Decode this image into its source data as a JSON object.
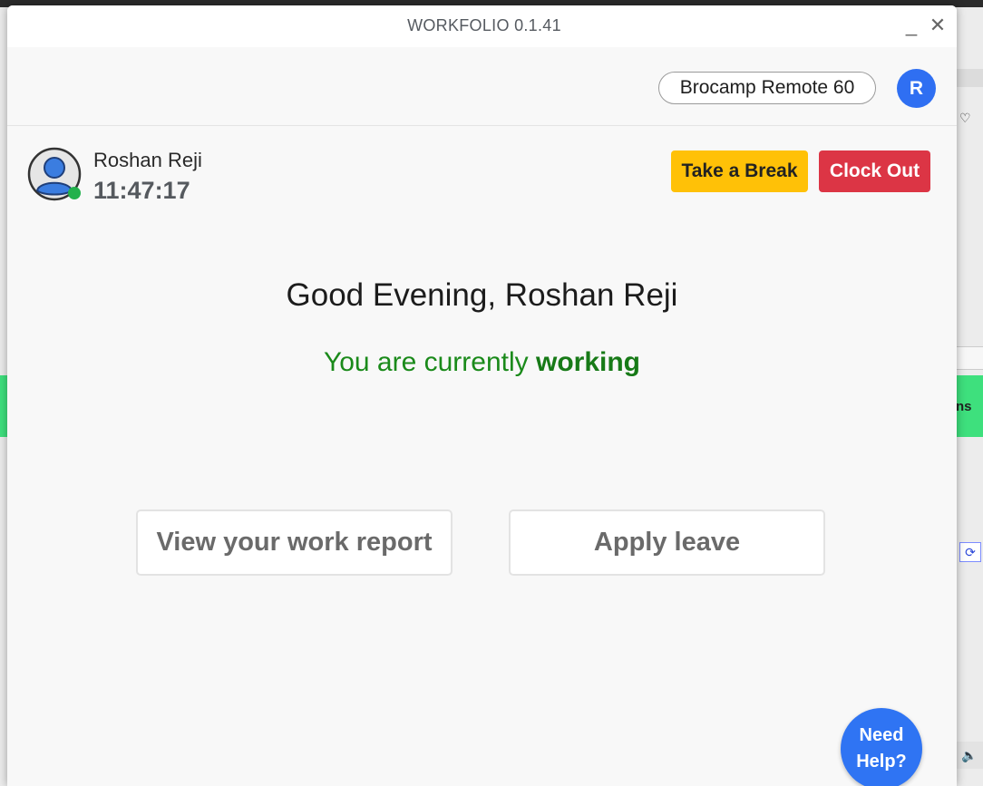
{
  "window": {
    "title": "WORKFOLIO 0.1.41",
    "minimize_glyph": "_",
    "close_glyph": "✕"
  },
  "header": {
    "workspace": "Brocamp Remote 60",
    "avatar_initial": "R"
  },
  "user": {
    "name": "Roshan Reji",
    "elapsed_time": "11:47:17",
    "online_status_color": "#22b14c"
  },
  "actions": {
    "take_break": "Take a Break",
    "clock_out": "Clock Out"
  },
  "main": {
    "greeting": "Good Evening, Roshan Reji",
    "status_prefix": "You are currently ",
    "status_value": "working"
  },
  "cards": {
    "work_report": "View your work report",
    "apply_leave": "Apply leave"
  },
  "help": {
    "line1": "Need",
    "line2": "Help?"
  },
  "background": {
    "right_green_text": "ns",
    "right_box_glyph": "⟳",
    "right_bottom_glyph": "🔈"
  },
  "colors": {
    "break_button": "#ffc107",
    "clockout_button": "#dc3545",
    "accent_blue": "#2f74f3",
    "working_green": "#1a8a1a"
  }
}
